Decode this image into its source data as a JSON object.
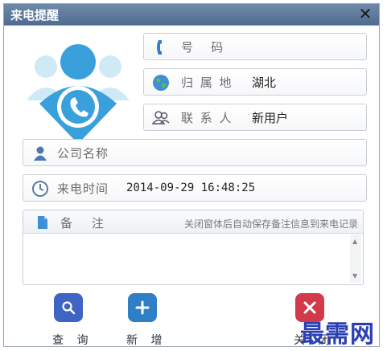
{
  "window": {
    "title": "来电提醒"
  },
  "fields": {
    "phone": {
      "label": "号   码",
      "value": ""
    },
    "location": {
      "label": "归 属 地",
      "value": "湖北"
    },
    "contact": {
      "label": "联 系 人",
      "value": "新用户"
    },
    "company": {
      "label": "公司名称",
      "value": ""
    },
    "time": {
      "label": "来电时间",
      "value": "2014-09-29 16:48:25"
    }
  },
  "notes": {
    "label": "备     注",
    "hint": "关闭窗体后自动保存备注信息到来电记录",
    "value": ""
  },
  "buttons": {
    "query": "查 询",
    "add": "新 增",
    "close": "关 闭"
  },
  "watermark": "最需网",
  "colors": {
    "accent": "#3aa0dc",
    "query": "#3e64c4",
    "add": "#2f7fc6",
    "close": "#d23a4c"
  }
}
